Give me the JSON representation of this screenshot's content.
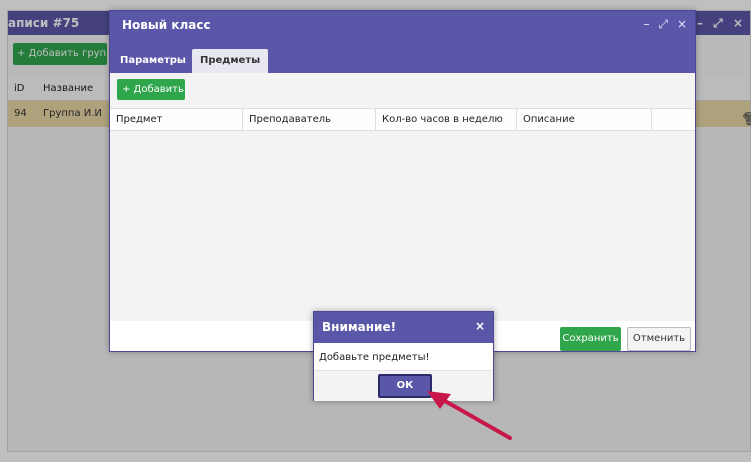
{
  "background": {
    "title": "аписи #75",
    "window_controls": "– ⤢ ×",
    "add_group_label": "+ Добавить группу",
    "columns": [
      "iD",
      "Название"
    ],
    "row": {
      "id": "94",
      "name": "Группа И.И"
    }
  },
  "modal": {
    "title": "Новый класс",
    "controls": {
      "minimize": "–",
      "maximize": "⤢",
      "close": "×"
    },
    "tabs": [
      {
        "label": "Параметры",
        "active": false
      },
      {
        "label": "Предметы",
        "active": true
      }
    ],
    "add_label": "+ Добавить",
    "columns": [
      "Предмет",
      "Преподаватель",
      "Кол-во часов в неделю",
      "Описание",
      ""
    ],
    "save_label": "Сохранить",
    "cancel_label": "Отменить"
  },
  "alert": {
    "title": "Внимание!",
    "close": "×",
    "message": "Добавьте предметы!",
    "ok_label": "ОК"
  },
  "colors": {
    "header_purple": "#5b57a8",
    "green": "#2fa64c",
    "row_highlight": "#e9d9a6",
    "arrow": "#c8184a"
  },
  "icons": {
    "edit": "pencil-icon",
    "delete": "trash-icon"
  }
}
